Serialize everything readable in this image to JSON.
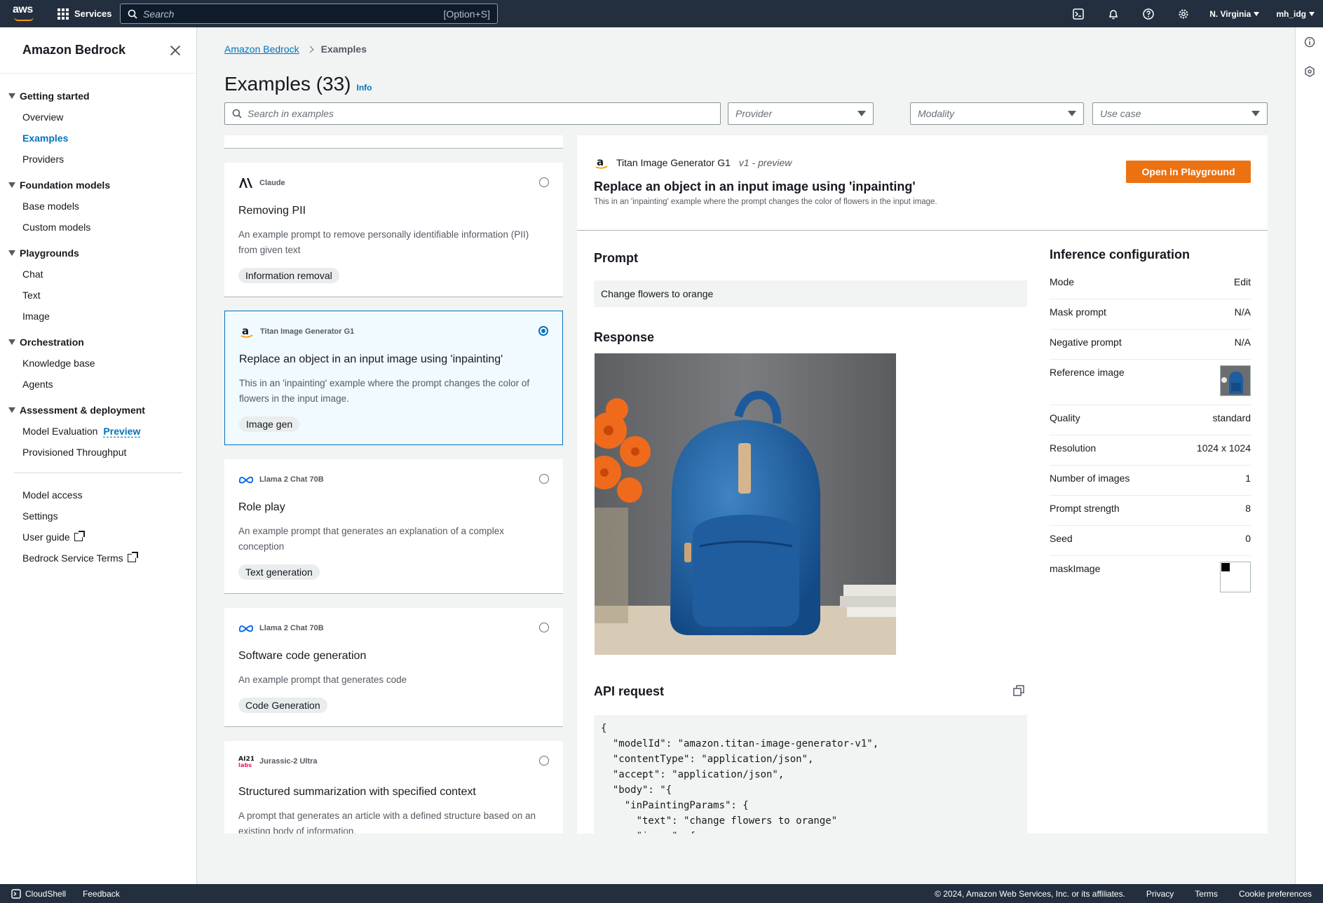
{
  "topnav": {
    "logo_text": "aws",
    "services_label": "Services",
    "search_placeholder": "Search",
    "search_shortcut": "[Option+S]",
    "region": "N. Virginia",
    "account": "mh_idg"
  },
  "sidebar": {
    "title": "Amazon Bedrock",
    "groups": [
      {
        "label": "Getting started",
        "items": [
          "Overview",
          "Examples",
          "Providers"
        ]
      },
      {
        "label": "Foundation models",
        "items": [
          "Base models",
          "Custom models"
        ]
      },
      {
        "label": "Playgrounds",
        "items": [
          "Chat",
          "Text",
          "Image"
        ]
      },
      {
        "label": "Orchestration",
        "items": [
          "Knowledge base",
          "Agents"
        ]
      },
      {
        "label": "Assessment & deployment",
        "items": [
          "Model Evaluation",
          "Provisioned Throughput"
        ]
      }
    ],
    "preview_label": "Preview",
    "bottom_items": [
      "Model access",
      "Settings",
      "User guide",
      "Bedrock Service Terms"
    ]
  },
  "breadcrumb": {
    "root": "Amazon Bedrock",
    "current": "Examples"
  },
  "page": {
    "title": "Examples (33)",
    "info": "Info"
  },
  "filters": {
    "search_placeholder": "Search in examples",
    "provider": "Provider",
    "modality": "Modality",
    "use_case": "Use case"
  },
  "cards": [
    {
      "provider": "Claude",
      "title": "Removing PII",
      "desc": "An example prompt to remove personally identifiable information (PII) from given text",
      "tag": "Information removal"
    },
    {
      "provider": "Titan Image Generator G1",
      "title": "Replace an object in an input image using 'inpainting'",
      "desc": "This in an 'inpainting' example where the prompt changes the color of flowers in the input image.",
      "tag": "Image gen"
    },
    {
      "provider": "Llama 2 Chat 70B",
      "title": "Role play",
      "desc": "An example prompt that generates an explanation of a complex conception",
      "tag": "Text generation"
    },
    {
      "provider": "Llama 2 Chat 70B",
      "title": "Software code generation",
      "desc": "An example prompt that generates code",
      "tag": "Code Generation"
    },
    {
      "provider": "Jurassic-2 Ultra",
      "title": "Structured summarization with specified context",
      "desc": "A prompt that generates an article with a defined structure based on an existing body of information.",
      "tag": ""
    }
  ],
  "detail": {
    "provider": "Titan Image Generator G1",
    "version": "v1 - preview",
    "title": "Replace an object in an input image using 'inpainting'",
    "desc": "This in an 'inpainting' example where the prompt changes the color of flowers in the input image.",
    "open_button": "Open in Playground",
    "prompt_heading": "Prompt",
    "prompt_text": "Change flowers to orange",
    "response_heading": "Response",
    "api_heading": "API request",
    "code": "{\n  \"modelId\": \"amazon.titan-image-generator-v1\",\n  \"contentType\": \"application/json\",\n  \"accept\": \"application/json\",\n  \"body\": \"{\n    \"inPaintingParams\": {\n      \"text\": \"change flowers to orange\"\n      \"image\": {"
  },
  "config": {
    "heading": "Inference configuration",
    "rows": [
      {
        "k": "Mode",
        "v": "Edit"
      },
      {
        "k": "Mask prompt",
        "v": "N/A"
      },
      {
        "k": "Negative prompt",
        "v": "N/A"
      },
      {
        "k": "Reference image",
        "v": ""
      },
      {
        "k": "Quality",
        "v": "standard"
      },
      {
        "k": "Resolution",
        "v": "1024 x 1024"
      },
      {
        "k": "Number of images",
        "v": "1"
      },
      {
        "k": "Prompt strength",
        "v": "8"
      },
      {
        "k": "Seed",
        "v": "0"
      },
      {
        "k": "maskImage",
        "v": ""
      }
    ]
  },
  "footer": {
    "cloudshell": "CloudShell",
    "feedback": "Feedback",
    "copyright": "© 2024, Amazon Web Services, Inc. or its affiliates.",
    "privacy": "Privacy",
    "terms": "Terms",
    "cookies": "Cookie preferences"
  },
  "colors": {
    "accent": "#0073bb",
    "primary_button": "#ec7211",
    "nav_bg": "#232f3e"
  }
}
